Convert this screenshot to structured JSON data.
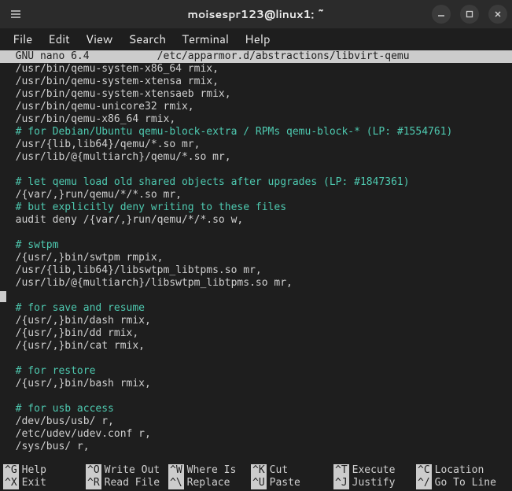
{
  "window": {
    "title": "moisespr123@linux1: ~"
  },
  "menubar": {
    "items": [
      "File",
      "Edit",
      "View",
      "Search",
      "Terminal",
      "Help"
    ]
  },
  "header": {
    "left": "  GNU nano 6.4",
    "path": "/etc/apparmor.d/abstractions/libvirt-qemu"
  },
  "content": {
    "lines": [
      {
        "t": "normal",
        "s": "  /usr/bin/qemu-system-x86_64 rmix,"
      },
      {
        "t": "normal",
        "s": "  /usr/bin/qemu-system-xtensa rmix,"
      },
      {
        "t": "normal",
        "s": "  /usr/bin/qemu-system-xtensaeb rmix,"
      },
      {
        "t": "normal",
        "s": "  /usr/bin/qemu-unicore32 rmix,"
      },
      {
        "t": "normal",
        "s": "  /usr/bin/qemu-x86_64 rmix,"
      },
      {
        "t": "comment",
        "s": "  # for Debian/Ubuntu qemu-block-extra / RPMs qemu-block-* (LP: #1554761)"
      },
      {
        "t": "normal",
        "s": "  /usr/{lib,lib64}/qemu/*.so mr,"
      },
      {
        "t": "normal",
        "s": "  /usr/lib/@{multiarch}/qemu/*.so mr,"
      },
      {
        "t": "blank",
        "s": ""
      },
      {
        "t": "comment",
        "s": "  # let qemu load old shared objects after upgrades (LP: #1847361)"
      },
      {
        "t": "normal",
        "s": "  /{var/,}run/qemu/*/*.so mr,"
      },
      {
        "t": "comment",
        "s": "  # but explicitly deny writing to these files"
      },
      {
        "t": "normal",
        "s": "  audit deny /{var/,}run/qemu/*/*.so w,"
      },
      {
        "t": "blank",
        "s": ""
      },
      {
        "t": "comment",
        "s": "  # swtpm"
      },
      {
        "t": "normal",
        "s": "  /{usr/,}bin/swtpm rmpix,"
      },
      {
        "t": "normal",
        "s": "  /usr/{lib,lib64}/libswtpm_libtpms.so mr,"
      },
      {
        "t": "normal",
        "s": "  /usr/lib/@{multiarch}/libswtpm_libtpms.so mr,"
      },
      {
        "t": "cursor",
        "s": ""
      },
      {
        "t": "comment",
        "s": "  # for save and resume"
      },
      {
        "t": "normal",
        "s": "  /{usr/,}bin/dash rmix,"
      },
      {
        "t": "normal",
        "s": "  /{usr/,}bin/dd rmix,"
      },
      {
        "t": "normal",
        "s": "  /{usr/,}bin/cat rmix,"
      },
      {
        "t": "blank",
        "s": ""
      },
      {
        "t": "comment",
        "s": "  # for restore"
      },
      {
        "t": "normal",
        "s": "  /{usr/,}bin/bash rmix,"
      },
      {
        "t": "blank",
        "s": ""
      },
      {
        "t": "comment",
        "s": "  # for usb access"
      },
      {
        "t": "normal",
        "s": "  /dev/bus/usb/ r,"
      },
      {
        "t": "normal",
        "s": "  /etc/udev/udev.conf r,"
      },
      {
        "t": "normal",
        "s": "  /sys/bus/ r,"
      }
    ]
  },
  "shortcuts": {
    "rows": [
      [
        {
          "k": "^G",
          "l": "Help"
        },
        {
          "k": "^O",
          "l": "Write Out"
        },
        {
          "k": "^W",
          "l": "Where Is"
        },
        {
          "k": "^K",
          "l": "Cut"
        },
        {
          "k": "^T",
          "l": "Execute"
        },
        {
          "k": "^C",
          "l": "Location"
        }
      ],
      [
        {
          "k": "^X",
          "l": "Exit"
        },
        {
          "k": "^R",
          "l": "Read File"
        },
        {
          "k": "^\\",
          "l": "Replace"
        },
        {
          "k": "^U",
          "l": "Paste"
        },
        {
          "k": "^J",
          "l": "Justify"
        },
        {
          "k": "^/",
          "l": "Go To Line"
        }
      ]
    ]
  }
}
